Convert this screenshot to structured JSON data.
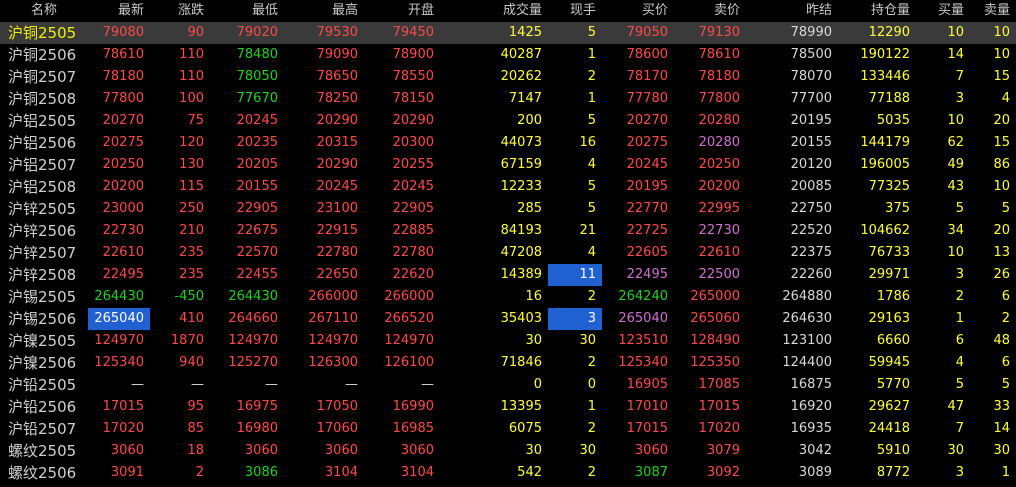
{
  "headers": [
    "名称",
    "最新",
    "涨跌",
    "最低",
    "最高",
    "开盘",
    "成交量",
    "现手",
    "买价",
    "卖价",
    "昨结",
    "持仓量",
    "买量",
    "卖量"
  ],
  "rows": [
    {
      "name": "沪铜2505",
      "selected": true,
      "cells": [
        [
          "79080",
          "r"
        ],
        [
          "90",
          "r"
        ],
        [
          "79020",
          "r"
        ],
        [
          "79530",
          "r"
        ],
        [
          "79450",
          "r"
        ],
        [
          "1425",
          "y"
        ],
        [
          "5",
          "y"
        ],
        [
          "79050",
          "r"
        ],
        [
          "79130",
          "r"
        ],
        [
          "78990",
          "w"
        ],
        [
          "12290",
          "y"
        ],
        [
          "10",
          "y"
        ],
        [
          "10",
          "y"
        ]
      ]
    },
    {
      "name": "沪铜2506",
      "cells": [
        [
          "78610",
          "r"
        ],
        [
          "110",
          "r"
        ],
        [
          "78480",
          "g"
        ],
        [
          "79090",
          "r"
        ],
        [
          "78900",
          "r"
        ],
        [
          "40287",
          "y"
        ],
        [
          "1",
          "y"
        ],
        [
          "78600",
          "r"
        ],
        [
          "78610",
          "r"
        ],
        [
          "78500",
          "w"
        ],
        [
          "190122",
          "y"
        ],
        [
          "14",
          "y"
        ],
        [
          "10",
          "y"
        ]
      ]
    },
    {
      "name": "沪铜2507",
      "cells": [
        [
          "78180",
          "r"
        ],
        [
          "110",
          "r"
        ],
        [
          "78050",
          "g"
        ],
        [
          "78650",
          "r"
        ],
        [
          "78550",
          "r"
        ],
        [
          "20262",
          "y"
        ],
        [
          "2",
          "y"
        ],
        [
          "78170",
          "r"
        ],
        [
          "78180",
          "r"
        ],
        [
          "78070",
          "w"
        ],
        [
          "133446",
          "y"
        ],
        [
          "7",
          "y"
        ],
        [
          "15",
          "y"
        ]
      ]
    },
    {
      "name": "沪铜2508",
      "cells": [
        [
          "77800",
          "r"
        ],
        [
          "100",
          "r"
        ],
        [
          "77670",
          "g"
        ],
        [
          "78250",
          "r"
        ],
        [
          "78150",
          "r"
        ],
        [
          "7147",
          "y"
        ],
        [
          "1",
          "y"
        ],
        [
          "77780",
          "r"
        ],
        [
          "77800",
          "r"
        ],
        [
          "77700",
          "w"
        ],
        [
          "77188",
          "y"
        ],
        [
          "3",
          "y"
        ],
        [
          "4",
          "y"
        ]
      ]
    },
    {
      "name": "沪铝2505",
      "cells": [
        [
          "20270",
          "r"
        ],
        [
          "75",
          "r"
        ],
        [
          "20245",
          "r"
        ],
        [
          "20290",
          "r"
        ],
        [
          "20290",
          "r"
        ],
        [
          "200",
          "y"
        ],
        [
          "5",
          "y"
        ],
        [
          "20270",
          "r"
        ],
        [
          "20280",
          "r"
        ],
        [
          "20195",
          "w"
        ],
        [
          "5035",
          "y"
        ],
        [
          "10",
          "y"
        ],
        [
          "20",
          "y"
        ]
      ]
    },
    {
      "name": "沪铝2506",
      "cells": [
        [
          "20275",
          "r"
        ],
        [
          "120",
          "r"
        ],
        [
          "20235",
          "r"
        ],
        [
          "20315",
          "r"
        ],
        [
          "20300",
          "r"
        ],
        [
          "44073",
          "y"
        ],
        [
          "16",
          "y"
        ],
        [
          "20275",
          "r"
        ],
        [
          "20280",
          "p"
        ],
        [
          "20155",
          "w"
        ],
        [
          "144179",
          "y"
        ],
        [
          "62",
          "y"
        ],
        [
          "15",
          "y"
        ]
      ]
    },
    {
      "name": "沪铝2507",
      "cells": [
        [
          "20250",
          "r"
        ],
        [
          "130",
          "r"
        ],
        [
          "20205",
          "r"
        ],
        [
          "20290",
          "r"
        ],
        [
          "20255",
          "r"
        ],
        [
          "67159",
          "y"
        ],
        [
          "4",
          "y"
        ],
        [
          "20245",
          "r"
        ],
        [
          "20250",
          "r"
        ],
        [
          "20120",
          "w"
        ],
        [
          "196005",
          "y"
        ],
        [
          "49",
          "y"
        ],
        [
          "86",
          "y"
        ]
      ]
    },
    {
      "name": "沪铝2508",
      "cells": [
        [
          "20200",
          "r"
        ],
        [
          "115",
          "r"
        ],
        [
          "20155",
          "r"
        ],
        [
          "20245",
          "r"
        ],
        [
          "20245",
          "r"
        ],
        [
          "12233",
          "y"
        ],
        [
          "5",
          "y"
        ],
        [
          "20195",
          "r"
        ],
        [
          "20200",
          "r"
        ],
        [
          "20085",
          "w"
        ],
        [
          "77325",
          "y"
        ],
        [
          "43",
          "y"
        ],
        [
          "10",
          "y"
        ]
      ]
    },
    {
      "name": "沪锌2505",
      "cells": [
        [
          "23000",
          "r"
        ],
        [
          "250",
          "r"
        ],
        [
          "22905",
          "r"
        ],
        [
          "23100",
          "r"
        ],
        [
          "22905",
          "r"
        ],
        [
          "285",
          "y"
        ],
        [
          "5",
          "y"
        ],
        [
          "22770",
          "r"
        ],
        [
          "22995",
          "r"
        ],
        [
          "22750",
          "w"
        ],
        [
          "375",
          "y"
        ],
        [
          "5",
          "y"
        ],
        [
          "5",
          "y"
        ]
      ]
    },
    {
      "name": "沪锌2506",
      "cells": [
        [
          "22730",
          "r"
        ],
        [
          "210",
          "r"
        ],
        [
          "22675",
          "r"
        ],
        [
          "22915",
          "r"
        ],
        [
          "22885",
          "r"
        ],
        [
          "84193",
          "y"
        ],
        [
          "21",
          "y"
        ],
        [
          "22725",
          "r"
        ],
        [
          "22730",
          "p"
        ],
        [
          "22520",
          "w"
        ],
        [
          "104662",
          "y"
        ],
        [
          "34",
          "y"
        ],
        [
          "20",
          "y"
        ]
      ]
    },
    {
      "name": "沪锌2507",
      "cells": [
        [
          "22610",
          "r"
        ],
        [
          "235",
          "r"
        ],
        [
          "22570",
          "r"
        ],
        [
          "22780",
          "r"
        ],
        [
          "22780",
          "r"
        ],
        [
          "47208",
          "y"
        ],
        [
          "4",
          "y"
        ],
        [
          "22605",
          "r"
        ],
        [
          "22610",
          "r"
        ],
        [
          "22375",
          "w"
        ],
        [
          "76733",
          "y"
        ],
        [
          "10",
          "y"
        ],
        [
          "13",
          "y"
        ]
      ]
    },
    {
      "name": "沪锌2508",
      "cells": [
        [
          "22495",
          "r"
        ],
        [
          "235",
          "r"
        ],
        [
          "22455",
          "r"
        ],
        [
          "22650",
          "r"
        ],
        [
          "22620",
          "r"
        ],
        [
          "14389",
          "y"
        ],
        [
          "11",
          "hl"
        ],
        [
          "22495",
          "p"
        ],
        [
          "22500",
          "p"
        ],
        [
          "22260",
          "w"
        ],
        [
          "29971",
          "y"
        ],
        [
          "3",
          "y"
        ],
        [
          "26",
          "y"
        ]
      ]
    },
    {
      "name": "沪锡2505",
      "cells": [
        [
          "264430",
          "g"
        ],
        [
          "-450",
          "g"
        ],
        [
          "264430",
          "g"
        ],
        [
          "266000",
          "r"
        ],
        [
          "266000",
          "r"
        ],
        [
          "16",
          "y"
        ],
        [
          "2",
          "y"
        ],
        [
          "264240",
          "g"
        ],
        [
          "265000",
          "r"
        ],
        [
          "264880",
          "w"
        ],
        [
          "1786",
          "y"
        ],
        [
          "2",
          "y"
        ],
        [
          "6",
          "y"
        ]
      ]
    },
    {
      "name": "沪锡2506",
      "cells": [
        [
          "265040",
          "hl"
        ],
        [
          "410",
          "r"
        ],
        [
          "264660",
          "r"
        ],
        [
          "267110",
          "r"
        ],
        [
          "266520",
          "r"
        ],
        [
          "35403",
          "y"
        ],
        [
          "3",
          "hl"
        ],
        [
          "265040",
          "p"
        ],
        [
          "265060",
          "r"
        ],
        [
          "264630",
          "w"
        ],
        [
          "29163",
          "y"
        ],
        [
          "1",
          "y"
        ],
        [
          "2",
          "y"
        ]
      ]
    },
    {
      "name": "沪镍2505",
      "cells": [
        [
          "124970",
          "r"
        ],
        [
          "1870",
          "r"
        ],
        [
          "124970",
          "r"
        ],
        [
          "124970",
          "r"
        ],
        [
          "124970",
          "r"
        ],
        [
          "30",
          "y"
        ],
        [
          "30",
          "y"
        ],
        [
          "123510",
          "r"
        ],
        [
          "128490",
          "r"
        ],
        [
          "123100",
          "w"
        ],
        [
          "6660",
          "y"
        ],
        [
          "6",
          "y"
        ],
        [
          "48",
          "y"
        ]
      ]
    },
    {
      "name": "沪镍2506",
      "cells": [
        [
          "125340",
          "r"
        ],
        [
          "940",
          "r"
        ],
        [
          "125270",
          "r"
        ],
        [
          "126300",
          "r"
        ],
        [
          "126100",
          "r"
        ],
        [
          "71846",
          "y"
        ],
        [
          "2",
          "y"
        ],
        [
          "125340",
          "r"
        ],
        [
          "125350",
          "r"
        ],
        [
          "124400",
          "w"
        ],
        [
          "59945",
          "y"
        ],
        [
          "4",
          "y"
        ],
        [
          "6",
          "y"
        ]
      ]
    },
    {
      "name": "沪铅2505",
      "cells": [
        [
          "—",
          "w"
        ],
        [
          "—",
          "w"
        ],
        [
          "—",
          "w"
        ],
        [
          "—",
          "w"
        ],
        [
          "—",
          "w"
        ],
        [
          "0",
          "y"
        ],
        [
          "0",
          "y"
        ],
        [
          "16905",
          "r"
        ],
        [
          "17085",
          "r"
        ],
        [
          "16875",
          "w"
        ],
        [
          "5770",
          "y"
        ],
        [
          "5",
          "y"
        ],
        [
          "5",
          "y"
        ]
      ]
    },
    {
      "name": "沪铅2506",
      "cells": [
        [
          "17015",
          "r"
        ],
        [
          "95",
          "r"
        ],
        [
          "16975",
          "r"
        ],
        [
          "17050",
          "r"
        ],
        [
          "16990",
          "r"
        ],
        [
          "13395",
          "y"
        ],
        [
          "1",
          "y"
        ],
        [
          "17010",
          "r"
        ],
        [
          "17015",
          "r"
        ],
        [
          "16920",
          "w"
        ],
        [
          "29627",
          "y"
        ],
        [
          "47",
          "y"
        ],
        [
          "33",
          "y"
        ]
      ]
    },
    {
      "name": "沪铅2507",
      "cells": [
        [
          "17020",
          "r"
        ],
        [
          "85",
          "r"
        ],
        [
          "16980",
          "r"
        ],
        [
          "17060",
          "r"
        ],
        [
          "16985",
          "r"
        ],
        [
          "6075",
          "y"
        ],
        [
          "2",
          "y"
        ],
        [
          "17015",
          "r"
        ],
        [
          "17020",
          "r"
        ],
        [
          "16935",
          "w"
        ],
        [
          "24418",
          "y"
        ],
        [
          "7",
          "y"
        ],
        [
          "14",
          "y"
        ]
      ]
    },
    {
      "name": "螺纹2505",
      "cells": [
        [
          "3060",
          "r"
        ],
        [
          "18",
          "r"
        ],
        [
          "3060",
          "r"
        ],
        [
          "3060",
          "r"
        ],
        [
          "3060",
          "r"
        ],
        [
          "30",
          "y"
        ],
        [
          "30",
          "y"
        ],
        [
          "3060",
          "r"
        ],
        [
          "3079",
          "r"
        ],
        [
          "3042",
          "w"
        ],
        [
          "5910",
          "y"
        ],
        [
          "30",
          "y"
        ],
        [
          "30",
          "y"
        ]
      ]
    },
    {
      "name": "螺纹2506",
      "cells": [
        [
          "3091",
          "r"
        ],
        [
          "2",
          "r"
        ],
        [
          "3086",
          "g"
        ],
        [
          "3104",
          "r"
        ],
        [
          "3104",
          "r"
        ],
        [
          "542",
          "y"
        ],
        [
          "2",
          "y"
        ],
        [
          "3087",
          "g"
        ],
        [
          "3092",
          "r"
        ],
        [
          "3089",
          "w"
        ],
        [
          "8772",
          "y"
        ],
        [
          "3",
          "y"
        ],
        [
          "1",
          "y"
        ]
      ]
    }
  ]
}
